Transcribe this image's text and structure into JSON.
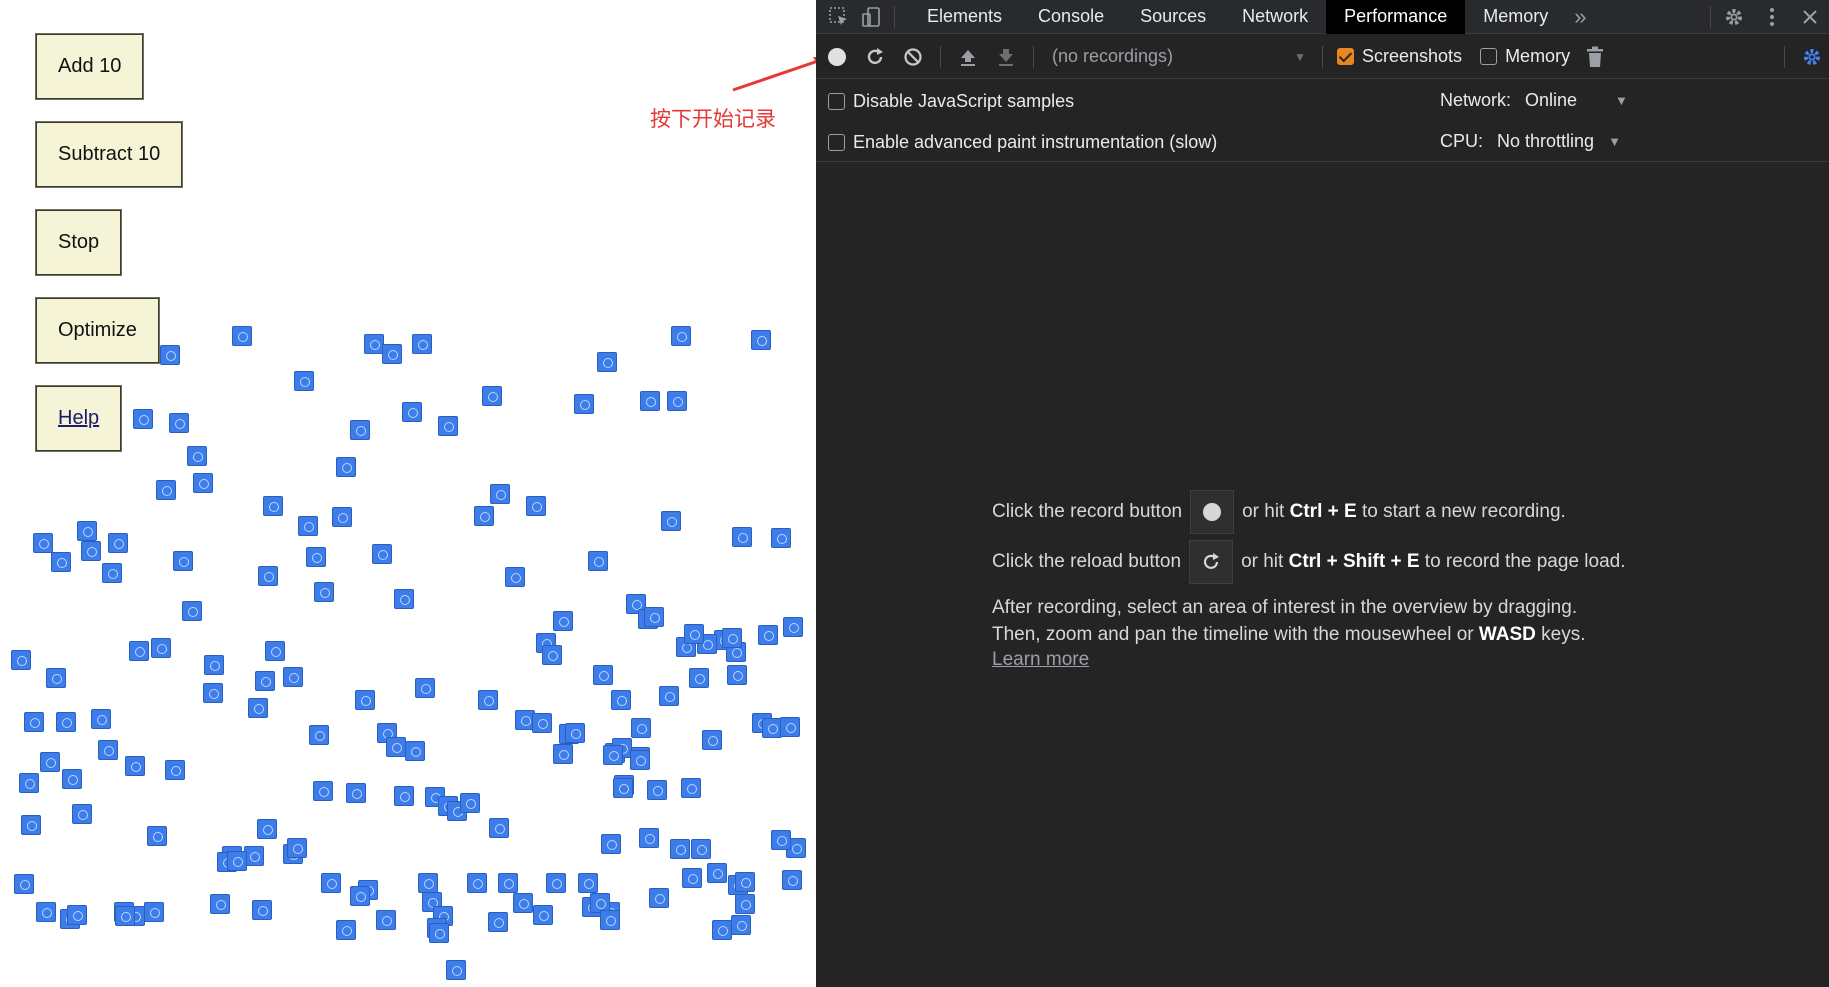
{
  "demo": {
    "buttons": [
      "Add 10",
      "Subtract 10",
      "Stop",
      "Optimize",
      "Help"
    ],
    "annotation": "按下开始记录"
  },
  "devtools": {
    "tabs": [
      "Elements",
      "Console",
      "Sources",
      "Network",
      "Performance",
      "Memory"
    ],
    "active_tab": "Performance",
    "more_tabs": "»",
    "toolbar": {
      "recordings_placeholder": "(no recordings)",
      "screenshots_label": "Screenshots",
      "screenshots_checked": true,
      "memory_label": "Memory",
      "memory_checked": false
    },
    "options": {
      "disable_js_samples": "Disable JavaScript samples",
      "enable_paint": "Enable advanced paint instrumentation (slow)",
      "network_label": "Network:",
      "network_value": "Online",
      "cpu_label": "CPU:",
      "cpu_value": "No throttling"
    },
    "landing": {
      "record_pre": "Click the record button",
      "record_post_1": "or hit ",
      "record_keys": "Ctrl + E",
      "record_post_2": " to start a new recording.",
      "reload_pre": "Click the reload button",
      "reload_post_1": "or hit ",
      "reload_keys": "Ctrl + Shift + E",
      "reload_post_2": " to record the page load.",
      "after_1": "After recording, select an area of interest in the overview by dragging.",
      "after_2a": "Then, zoom and pan the timeline with the mousewheel or ",
      "after_2b": "WASD",
      "after_2c": " keys.",
      "learn_more": "Learn more"
    },
    "colors": {
      "accent_checkbox": "#e8871e",
      "settings_blue": "#4285f4",
      "annotation_red": "#e53935"
    }
  }
}
